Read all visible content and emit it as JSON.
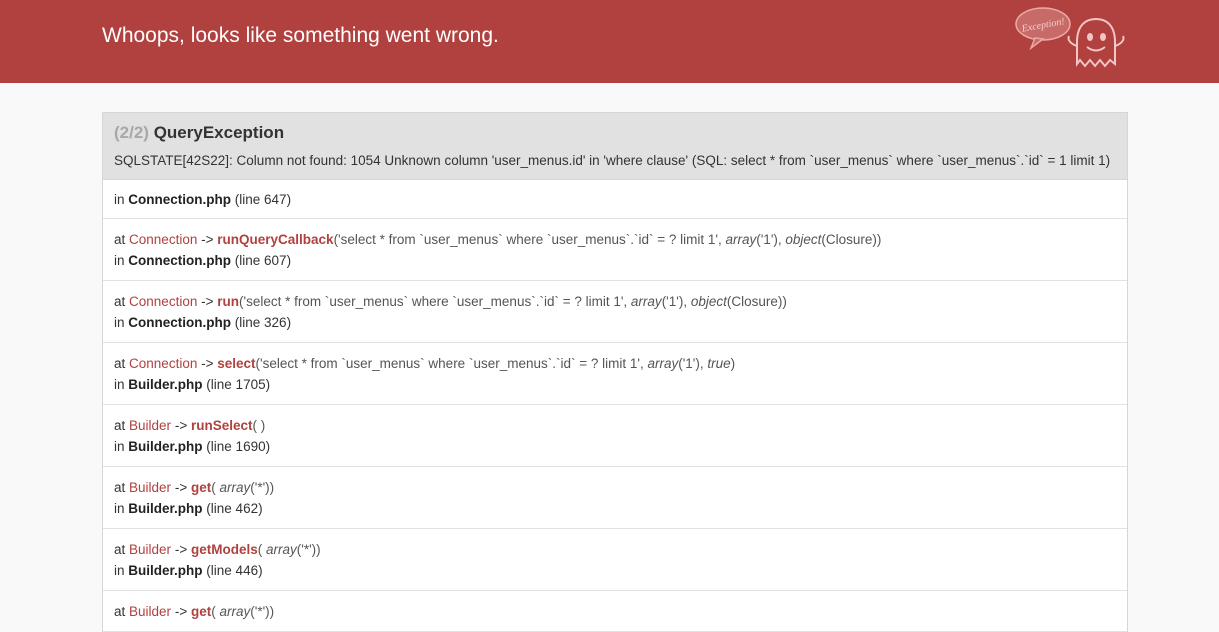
{
  "header": {
    "title": "Whoops, looks like something went wrong.",
    "mascot_text": "Exception!"
  },
  "exception": {
    "count": "(2/2)",
    "name": "QueryException",
    "message": "SQLSTATE[42S22]: Column not found: 1054 Unknown column 'user_menus.id' in 'where clause' (SQL: select * from `user_menus` where `user_menus`.`id` = 1 limit 1)"
  },
  "trace": {
    "first": {
      "in": "in",
      "file": "Connection.php",
      "line": "(line 647)"
    },
    "frames": [
      {
        "at": "at",
        "class": "Connection",
        "arrow": "->",
        "method": "runQueryCallback",
        "args": [
          {
            "text": "('select * from `user_menus` where `user_menus`.`id` = ? limit 1', ",
            "italic": false
          },
          {
            "text": "array",
            "italic": true
          },
          {
            "text": "('1'), ",
            "italic": false
          },
          {
            "text": "object",
            "italic": true
          },
          {
            "text": "(Closure))",
            "italic": false
          }
        ],
        "in": "in",
        "file": "Connection.php",
        "line": "(line 607)"
      },
      {
        "at": "at",
        "class": "Connection",
        "arrow": "->",
        "method": "run",
        "args": [
          {
            "text": "('select * from `user_menus` where `user_menus`.`id` = ? limit 1', ",
            "italic": false
          },
          {
            "text": "array",
            "italic": true
          },
          {
            "text": "('1'), ",
            "italic": false
          },
          {
            "text": "object",
            "italic": true
          },
          {
            "text": "(Closure))",
            "italic": false
          }
        ],
        "in": "in",
        "file": "Connection.php",
        "line": "(line 326)"
      },
      {
        "at": "at",
        "class": "Connection",
        "arrow": "->",
        "method": "select",
        "args": [
          {
            "text": "('select * from `user_menus` where `user_menus`.`id` = ? limit 1', ",
            "italic": false
          },
          {
            "text": "array",
            "italic": true
          },
          {
            "text": "('1'), ",
            "italic": false
          },
          {
            "text": "true",
            "italic": true
          },
          {
            "text": ")",
            "italic": false
          }
        ],
        "in": "in",
        "file": "Builder.php",
        "line": "(line 1705)"
      },
      {
        "at": "at",
        "class": "Builder",
        "arrow": "->",
        "method": "runSelect",
        "args": [
          {
            "text": "( )",
            "italic": false
          }
        ],
        "in": "in",
        "file": "Builder.php",
        "line": "(line 1690)"
      },
      {
        "at": "at",
        "class": "Builder",
        "arrow": "->",
        "method": "get",
        "args": [
          {
            "text": "( ",
            "italic": false
          },
          {
            "text": "array",
            "italic": true
          },
          {
            "text": "('*'))",
            "italic": false
          }
        ],
        "in": "in",
        "file": "Builder.php",
        "line": "(line 462)"
      },
      {
        "at": "at",
        "class": "Builder",
        "arrow": "->",
        "method": "getModels",
        "args": [
          {
            "text": "( ",
            "italic": false
          },
          {
            "text": "array",
            "italic": true
          },
          {
            "text": "('*'))",
            "italic": false
          }
        ],
        "in": "in",
        "file": "Builder.php",
        "line": "(line 446)"
      },
      {
        "at": "at",
        "class": "Builder",
        "arrow": "->",
        "method": "get",
        "args": [
          {
            "text": "( ",
            "italic": false
          },
          {
            "text": "array",
            "italic": true
          },
          {
            "text": "('*'))",
            "italic": false
          }
        ],
        "in": "",
        "file": "",
        "line": ""
      }
    ]
  },
  "colors": {
    "header_bg": "#b0413e",
    "accent": "#b0413e",
    "exception_bg": "#e1e1e1",
    "page_bg": "#f9f9f9"
  }
}
